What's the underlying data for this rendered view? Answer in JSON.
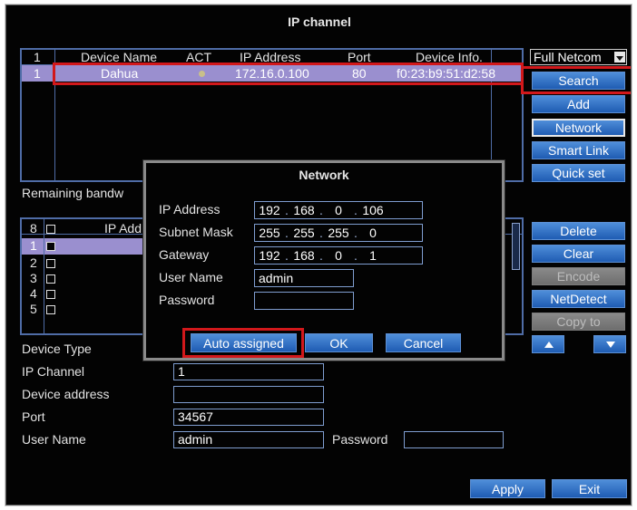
{
  "window": {
    "title": "IP channel"
  },
  "device_table": {
    "headers": {
      "index": "1",
      "name": "Device Name",
      "act": "ACT",
      "ip": "IP Address",
      "port": "Port",
      "info": "Device Info."
    },
    "rows": [
      {
        "index": "1",
        "name": "Dahua",
        "ip": "172.16.0.100",
        "port": "80",
        "info": "f0:23:b9:51:d2:58"
      }
    ]
  },
  "protocol_select": {
    "value": "Full Netcom"
  },
  "right_buttons_top": {
    "search": "Search",
    "add": "Add",
    "network": "Network",
    "smart_link": "Smart Link",
    "quick_set": "Quick set"
  },
  "remaining_label": "Remaining bandw",
  "channel_table": {
    "header_index": "8",
    "header_ip": "IP Add",
    "rows": [
      "1",
      "2",
      "3",
      "4",
      "5"
    ]
  },
  "right_buttons_bottom": {
    "delete": "Delete",
    "clear": "Clear",
    "encode": "Encode",
    "netdetect": "NetDetect",
    "copy_to": "Copy to"
  },
  "nav_icons": {
    "up": "triangle-up-icon",
    "down": "triangle-down-icon"
  },
  "form": {
    "device_type_label": "Device Type",
    "ip_channel_label": "IP Channel",
    "ip_channel_value": "1",
    "device_address_label": "Device address",
    "device_address_value": "",
    "port_label": "Port",
    "port_value": "34567",
    "user_name_label": "User Name",
    "user_name_value": "admin",
    "password_label": "Password",
    "password_value": ""
  },
  "bottom_buttons": {
    "apply": "Apply",
    "exit": "Exit"
  },
  "network_dialog": {
    "title": "Network",
    "ip_label": "IP Address",
    "ip": [
      "192",
      "168",
      "0",
      "106"
    ],
    "mask_label": "Subnet Mask",
    "mask": [
      "255",
      "255",
      "255",
      "0"
    ],
    "gateway_label": "Gateway",
    "gateway": [
      "192",
      "168",
      "0",
      "1"
    ],
    "user_label": "User Name",
    "user_value": "admin",
    "password_label": "Password",
    "password_value": "",
    "auto_button": "Auto assigned",
    "ok_button": "OK",
    "cancel_button": "Cancel"
  }
}
